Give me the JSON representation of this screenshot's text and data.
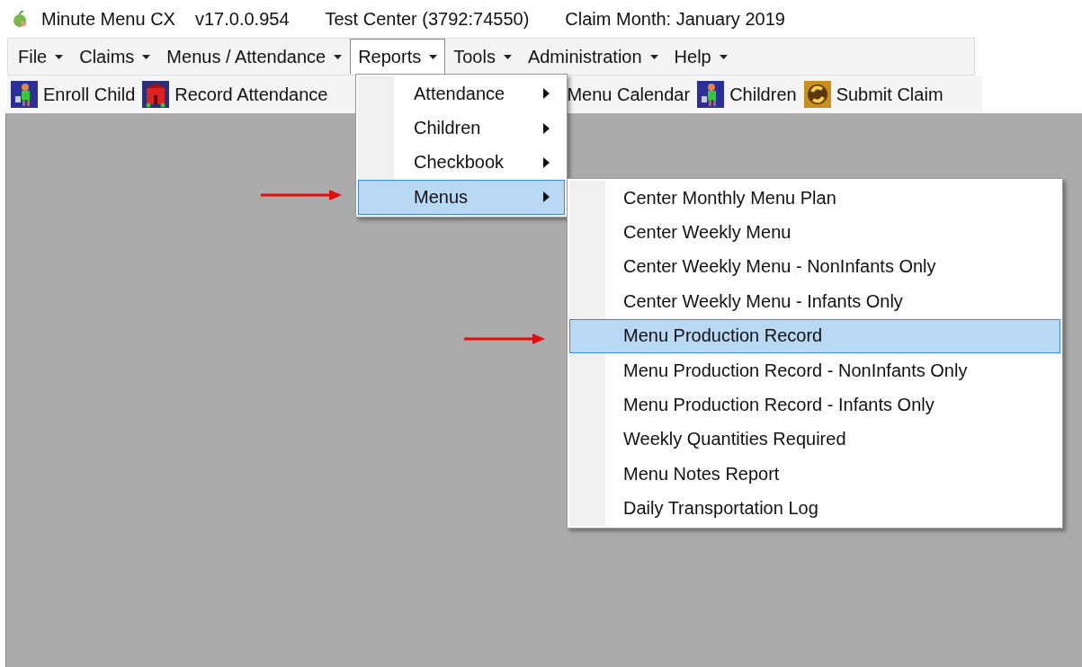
{
  "title_bar": {
    "app_name": "Minute Menu CX",
    "version": "v17.0.0.954",
    "center": "Test Center (3792:74550)",
    "claim_month": "Claim Month: January 2019"
  },
  "menu_bar": [
    {
      "label": "File",
      "selected": false
    },
    {
      "label": "Claims",
      "selected": false
    },
    {
      "label": "Menus / Attendance",
      "selected": false
    },
    {
      "label": "Reports",
      "selected": true
    },
    {
      "label": "Tools",
      "selected": false
    },
    {
      "label": "Administration",
      "selected": false
    },
    {
      "label": "Help",
      "selected": false
    }
  ],
  "toolbar": [
    {
      "label": "Enroll Child",
      "kind": "figure"
    },
    {
      "label": "Record Attendance",
      "kind": "building"
    },
    {
      "label": "Menu Calendar",
      "kind": "covered"
    },
    {
      "label": "Children",
      "kind": "figure"
    },
    {
      "label": "Submit Claim",
      "kind": "coin"
    }
  ],
  "reports_menu": [
    {
      "label": "Attendance",
      "selected": false
    },
    {
      "label": "Children",
      "selected": false
    },
    {
      "label": "Checkbook",
      "selected": false
    },
    {
      "label": "Menus",
      "selected": true
    }
  ],
  "menus_submenu": [
    {
      "label": "Center Monthly Menu Plan",
      "selected": false
    },
    {
      "label": "Center Weekly Menu",
      "selected": false
    },
    {
      "label": "Center Weekly Menu - NonInfants Only",
      "selected": false
    },
    {
      "label": "Center Weekly Menu - Infants Only",
      "selected": false
    },
    {
      "label": "Menu Production Record",
      "selected": true
    },
    {
      "label": "Menu Production Record - NonInfants Only",
      "selected": false
    },
    {
      "label": "Menu Production Record - Infants Only",
      "selected": false
    },
    {
      "label": "Weekly Quantities Required",
      "selected": false
    },
    {
      "label": "Menu Notes Report",
      "selected": false
    },
    {
      "label": "Daily Transportation Log",
      "selected": false
    }
  ]
}
